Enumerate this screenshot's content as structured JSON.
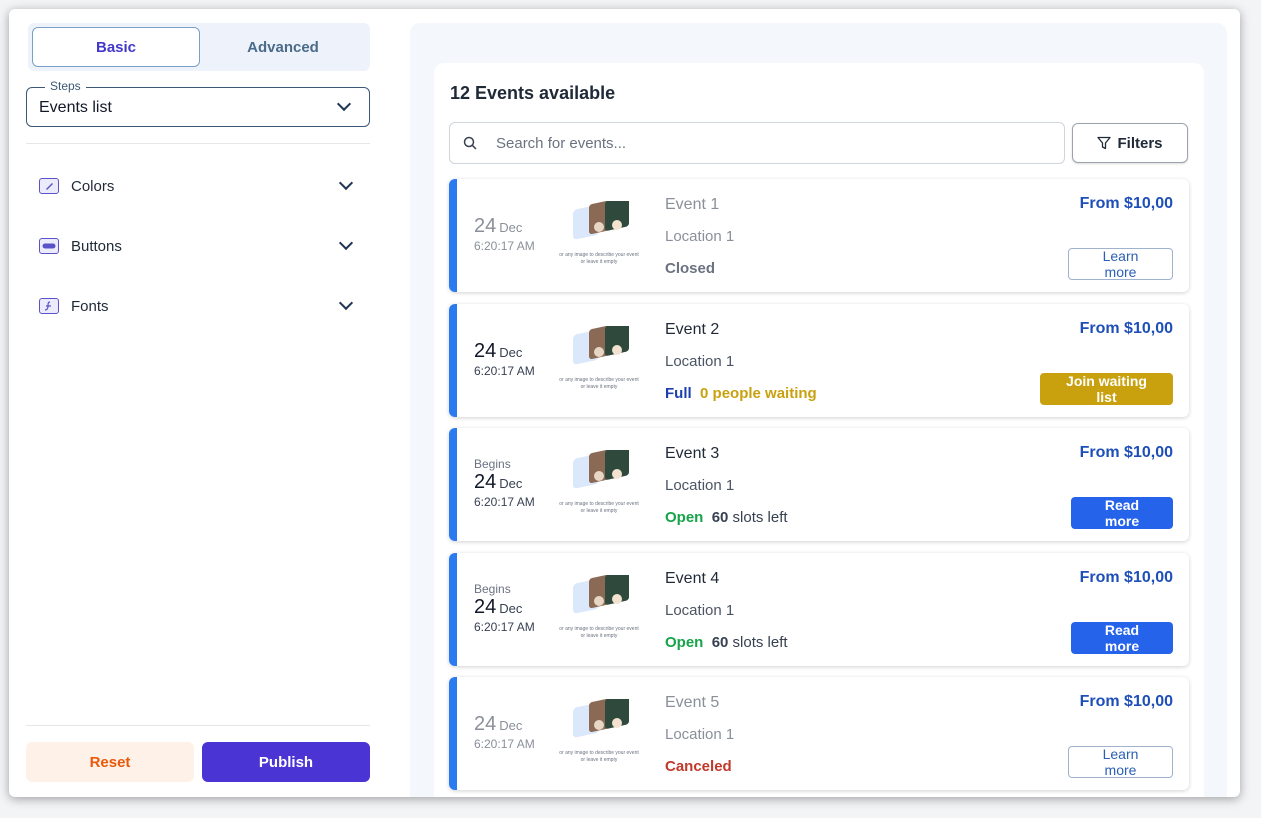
{
  "sidebar": {
    "tabs": [
      {
        "label": "Basic",
        "active": true
      },
      {
        "label": "Advanced",
        "active": false
      }
    ],
    "steps": {
      "legend": "Steps",
      "value": "Events list"
    },
    "sections": [
      {
        "label": "Colors",
        "icon": "paint-brush-icon"
      },
      {
        "label": "Buttons",
        "icon": "button-icon"
      },
      {
        "label": "Fonts",
        "icon": "font-icon"
      }
    ],
    "reset_label": "Reset",
    "publish_label": "Publish"
  },
  "main": {
    "title": "12 Events available",
    "search_placeholder": "Search for events...",
    "filters_label": "Filters",
    "thumb_caption": "or any image to describe your event or leave it empty",
    "events": [
      {
        "day": "24",
        "month": "Dec",
        "time": "6:20:17 AM",
        "begins": "",
        "title": "Event 1",
        "location": "Location 1",
        "status": "Closed",
        "extra": "",
        "price": "From $10,00",
        "button": "Learn more"
      },
      {
        "day": "24",
        "month": "Dec",
        "time": "6:20:17 AM",
        "begins": "",
        "title": "Event 2",
        "location": "Location 1",
        "status": "Full",
        "extra": "0 people waiting",
        "price": "From $10,00",
        "button": "Join waiting list"
      },
      {
        "day": "24",
        "month": "Dec",
        "time": "6:20:17 AM",
        "begins": "Begins",
        "title": "Event 3",
        "location": "Location 1",
        "status": "Open",
        "slots": "60",
        "extra": "slots left",
        "price": "From $10,00",
        "button": "Read more"
      },
      {
        "day": "24",
        "month": "Dec",
        "time": "6:20:17 AM",
        "begins": "Begins",
        "title": "Event 4",
        "location": "Location 1",
        "status": "Open",
        "slots": "60",
        "extra": "slots left",
        "price": "From $10,00",
        "button": "Read more"
      },
      {
        "day": "24",
        "month": "Dec",
        "time": "6:20:17 AM",
        "begins": "",
        "title": "Event 5",
        "location": "Location 1",
        "status": "Canceled",
        "extra": "",
        "price": "From $10,00",
        "button": "Learn more"
      }
    ]
  },
  "colors": {
    "accent": "#4a35d4",
    "event_bar": "#2b7bf0",
    "closed": "#6b7280",
    "full": "#1e40af",
    "waiting": "#c9a10f",
    "open": "#16a34a",
    "canceled": "#c0392b"
  }
}
